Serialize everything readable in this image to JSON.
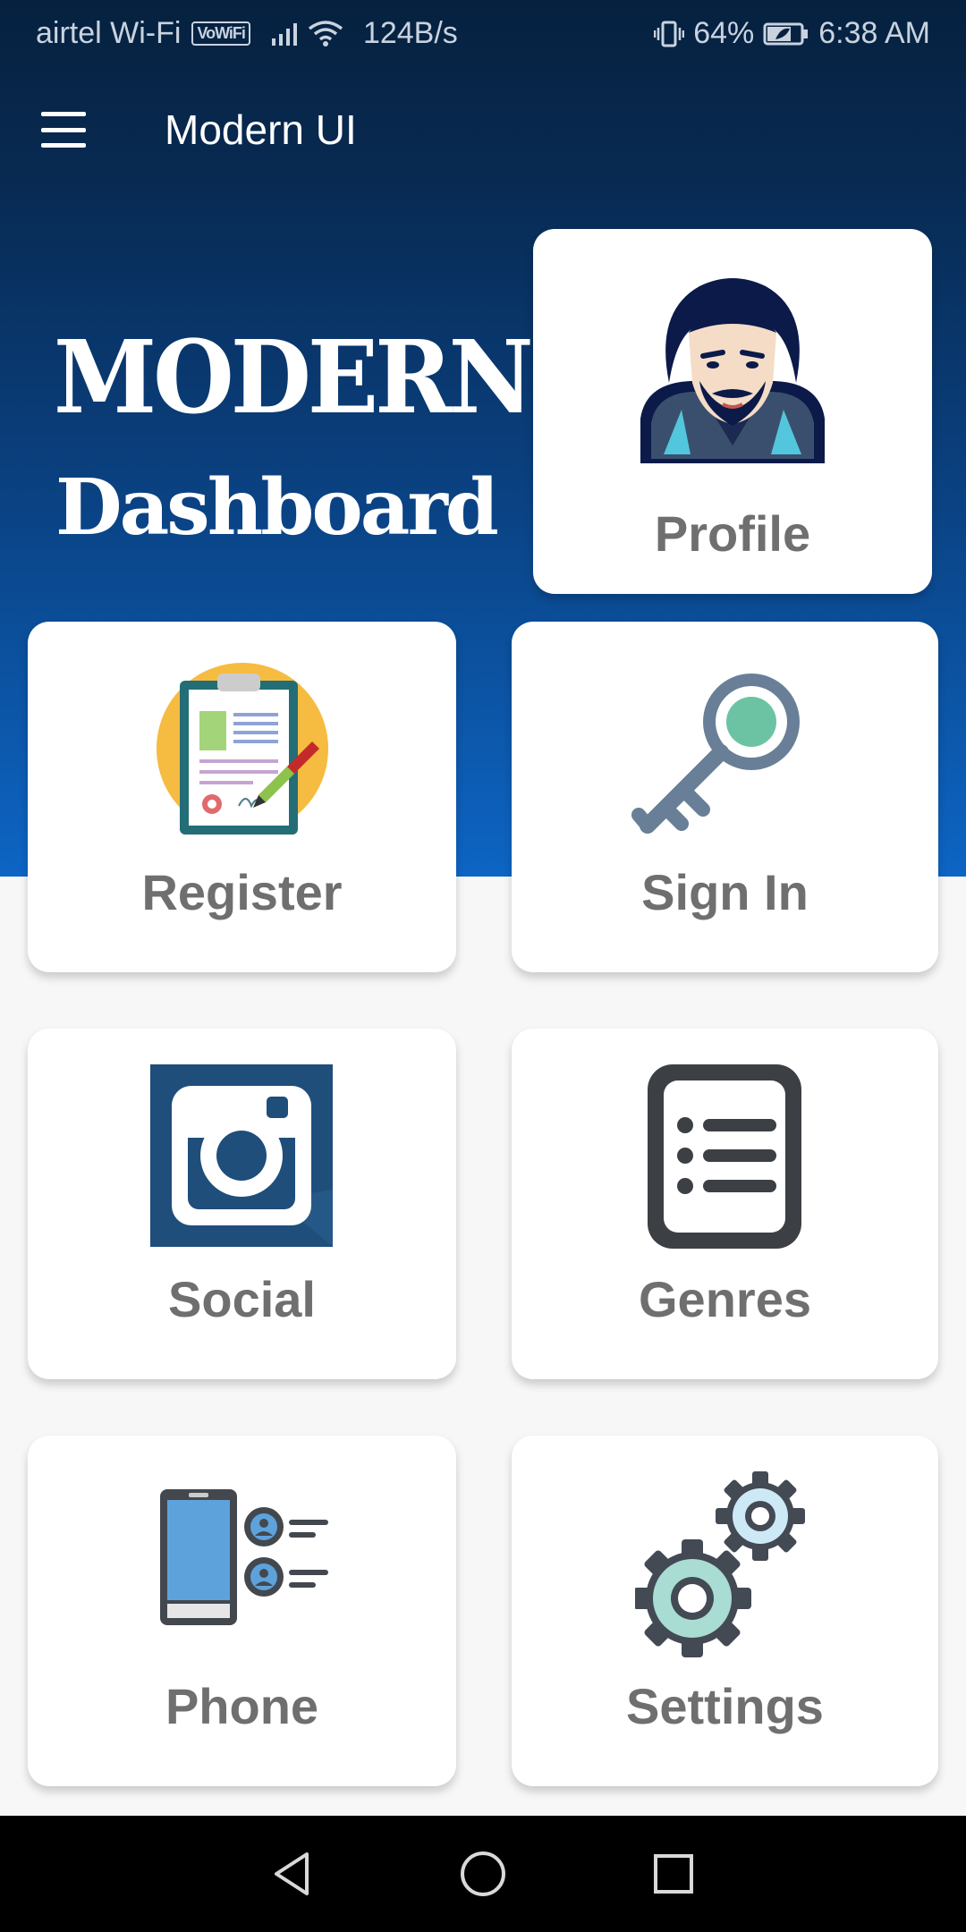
{
  "status_bar": {
    "carrier": "airtel Wi-Fi",
    "vowifi": "VoWiFi",
    "speed": "124B/s",
    "battery": "64%",
    "time": "6:38 AM",
    "icons": [
      "signal-icon",
      "wifi-icon",
      "vibrate-icon",
      "battery-icon"
    ]
  },
  "app_bar": {
    "title": "Modern UI",
    "menu_icon": "hamburger-menu-icon"
  },
  "hero": {
    "title": "MODERN UI",
    "subtitle": "Dashboard"
  },
  "cards": [
    {
      "label": "Profile",
      "icon": "profile-avatar-icon"
    },
    {
      "label": "Register",
      "icon": "clipboard-icon"
    },
    {
      "label": "Sign In",
      "icon": "key-icon"
    },
    {
      "label": "Social",
      "icon": "instagram-icon"
    },
    {
      "label": "Genres",
      "icon": "list-icon"
    },
    {
      "label": "Phone",
      "icon": "phone-contacts-icon"
    },
    {
      "label": "Settings",
      "icon": "gears-icon"
    }
  ],
  "nav_bar": {
    "icons": [
      "back-icon",
      "home-icon",
      "recents-icon"
    ]
  },
  "colors": {
    "header_dark": "#06213f",
    "header_light": "#0d65c4",
    "card_label": "#6f6f6f",
    "background": "#f7f7f7"
  }
}
